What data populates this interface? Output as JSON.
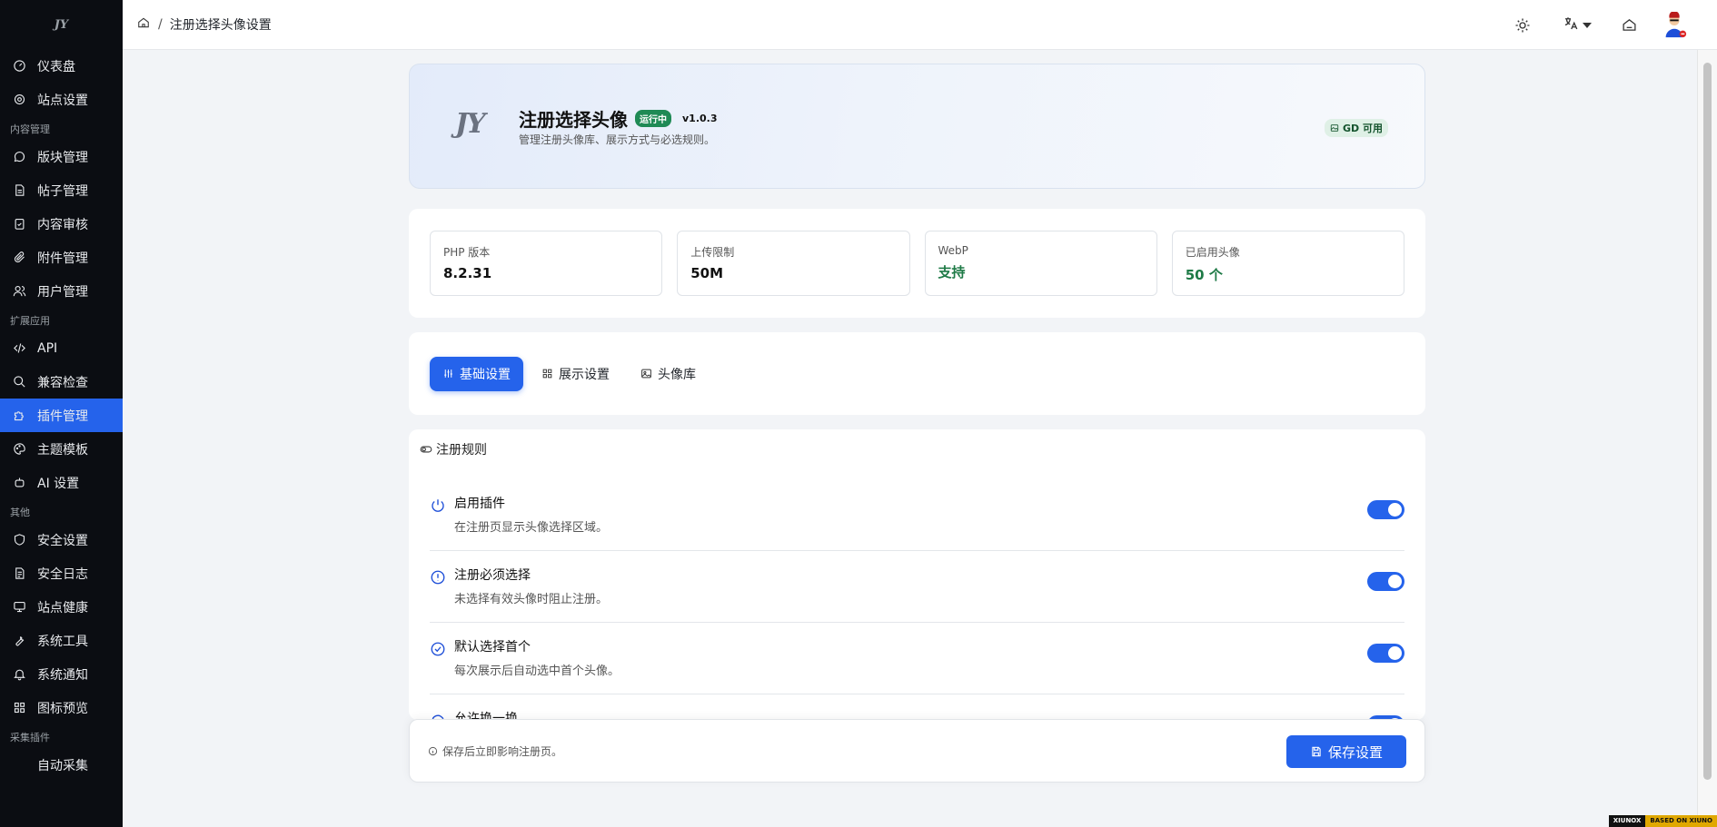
{
  "sidebar": {
    "logo": "JY",
    "items": [
      {
        "label": "仪表盘",
        "icon": "dashboard-icon",
        "active": false
      },
      {
        "label": "站点设置",
        "icon": "gear-icon",
        "active": false
      },
      {
        "group": "内容管理"
      },
      {
        "label": "版块管理",
        "icon": "chat-bubble-icon",
        "active": false
      },
      {
        "label": "帖子管理",
        "icon": "document-icon",
        "active": false
      },
      {
        "label": "内容审核",
        "icon": "clipboard-check-icon",
        "active": false
      },
      {
        "label": "附件管理",
        "icon": "paperclip-icon",
        "active": false
      },
      {
        "label": "用户管理",
        "icon": "users-icon",
        "active": false
      },
      {
        "group": "扩展应用"
      },
      {
        "label": "API",
        "icon": "code-icon",
        "active": false
      },
      {
        "label": "兼容检查",
        "icon": "search-icon",
        "active": false
      },
      {
        "label": "插件管理",
        "icon": "puzzle-icon",
        "active": true
      },
      {
        "label": "主题模板",
        "icon": "palette-icon",
        "active": false
      },
      {
        "label": "AI 设置",
        "icon": "robot-icon",
        "active": false
      },
      {
        "group": "其他"
      },
      {
        "label": "安全设置",
        "icon": "shield-icon",
        "active": false
      },
      {
        "label": "安全日志",
        "icon": "log-icon",
        "active": false
      },
      {
        "label": "站点健康",
        "icon": "monitor-icon",
        "active": false
      },
      {
        "label": "系统工具",
        "icon": "wrench-icon",
        "active": false
      },
      {
        "label": "系统通知",
        "icon": "bell-icon",
        "active": false
      },
      {
        "label": "图标预览",
        "icon": "grid-icon",
        "active": false
      },
      {
        "group": "采集插件"
      },
      {
        "label": "自动采集",
        "icon": "",
        "active": false
      }
    ]
  },
  "breadcrumb": {
    "separator": "/",
    "current": "注册选择头像设置"
  },
  "hero": {
    "logo": "JY",
    "title": "注册选择头像",
    "status_badge": "运行中",
    "version": "v1.0.3",
    "description": "管理注册头像库、展示方式与必选规则。",
    "gd_badge": "GD 可用"
  },
  "stats": [
    {
      "label": "PHP 版本",
      "value": "8.2.31",
      "highlight": false
    },
    {
      "label": "上传限制",
      "value": "50M",
      "highlight": false
    },
    {
      "label": "WebP",
      "value": "支持",
      "highlight": true
    },
    {
      "label": "已启用头像",
      "value": "50 个",
      "highlight": true
    }
  ],
  "tabs": [
    {
      "label": "基础设置",
      "icon": "sliders-icon",
      "active": true
    },
    {
      "label": "展示设置",
      "icon": "grid-icon",
      "active": false
    },
    {
      "label": "头像库",
      "icon": "image-icon",
      "active": false
    }
  ],
  "rules": {
    "title": "注册规则",
    "items": [
      {
        "name": "启用插件",
        "desc": "在注册页显示头像选择区域。",
        "icon": "power-icon",
        "enabled": true
      },
      {
        "name": "注册必须选择",
        "desc": "未选择有效头像时阻止注册。",
        "icon": "alert-circle-icon",
        "enabled": true
      },
      {
        "name": "默认选择首个",
        "desc": "每次展示后自动选中首个头像。",
        "icon": "check-circle-icon",
        "enabled": true
      },
      {
        "name": "允许换一换",
        "desc": "",
        "icon": "refresh-icon",
        "enabled": true
      }
    ]
  },
  "savebar": {
    "hint": "保存后立即影响注册页。",
    "button": "保存设置"
  },
  "footer_badge": {
    "left": "XIUNOX",
    "right": "BASED ON XIUNO"
  },
  "colors": {
    "accent": "#2563eb",
    "sidebar_bg": "#0b0d12",
    "success": "#1f8a55"
  }
}
